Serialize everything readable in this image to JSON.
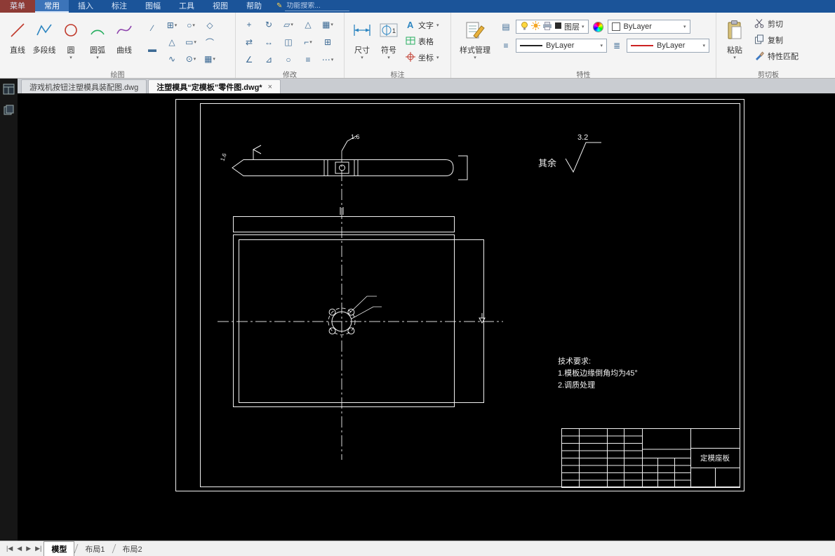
{
  "menubar": {
    "menu_button": "菜单",
    "tabs": [
      {
        "label": "常用",
        "active": true
      },
      {
        "label": "插入",
        "active": false
      },
      {
        "label": "标注",
        "active": false
      },
      {
        "label": "图幅",
        "active": false
      },
      {
        "label": "工具",
        "active": false
      },
      {
        "label": "视图",
        "active": false
      },
      {
        "label": "帮助",
        "active": false
      }
    ],
    "search_placeholder": "功能搜索..."
  },
  "ribbon": {
    "draw_panel": {
      "label": "绘图",
      "big_tools": [
        "直线",
        "多段线",
        "圆",
        "圆弧",
        "曲线"
      ]
    },
    "modify_panel": {
      "label": "修改"
    },
    "annotate_panel": {
      "label": "标注",
      "big_tools": [
        "尺寸",
        "符号"
      ],
      "list_tools": [
        "文字",
        "表格",
        "坐标"
      ]
    },
    "properties_panel": {
      "label": "特性",
      "style_manager": "样式管理",
      "layer_group_label": "图层",
      "color_value": "ByLayer",
      "linetype_value": "ByLayer",
      "lineweight_value": "ByLayer"
    },
    "clipboard_panel": {
      "label": "剪切板",
      "paste": "粘贴",
      "cut": "剪切",
      "copy": "复制",
      "match": "特性匹配"
    }
  },
  "file_tabs": [
    {
      "label": "游戏机按钮注塑模具装配图.dwg",
      "active": false
    },
    {
      "label": "注塑模具“定模板”零件图.dwg*",
      "active": true
    }
  ],
  "drawing": {
    "surface_default_label": "其余",
    "surface_default_value": "3.2",
    "finish_top": "1.6",
    "finish_left": "1.6",
    "tech_requirements": [
      "技术要求:",
      "1.模板边缘倒角均为45°",
      "2.调质处理"
    ],
    "title_block_part_name": "定模座板"
  },
  "statusbar": {
    "layout_tabs": [
      {
        "label": "模型",
        "active": true
      },
      {
        "label": "布局1",
        "active": false
      },
      {
        "label": "布局2",
        "active": false
      }
    ]
  },
  "colors": {
    "menubar_blue": "#1b5499",
    "canvas_black": "#000000",
    "line_white": "#f0f0f0",
    "accent_red": "#cc2222"
  }
}
